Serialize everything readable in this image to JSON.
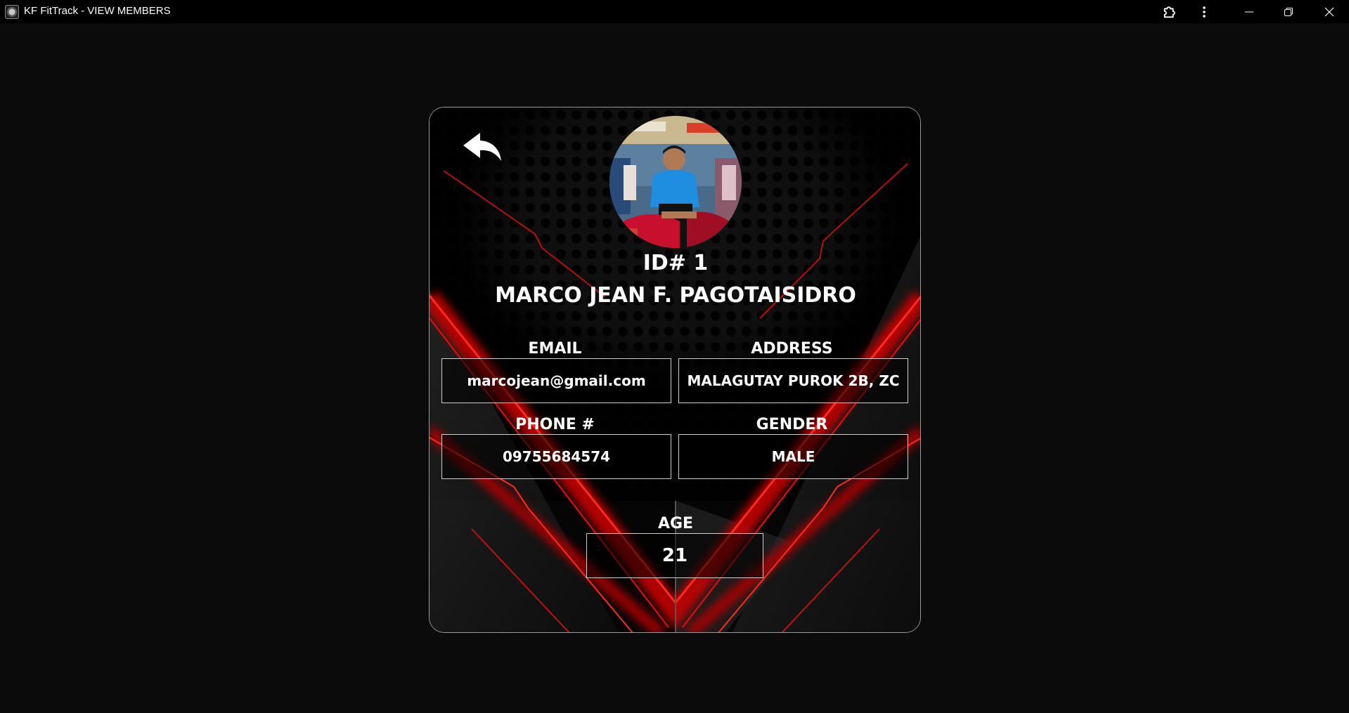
{
  "window": {
    "title": "KF FitTrack - VIEW MEMBERS"
  },
  "icons": {
    "app": "dumbbell-plate-icon",
    "extensions": "puzzle-icon",
    "more": "more-vertical-icon",
    "minimize": "minimize-icon",
    "restore": "restore-icon",
    "close": "close-icon",
    "back": "back-arrow-icon"
  },
  "member": {
    "id_text": "ID# 1",
    "name": "MARCO JEAN F. PAGOTAISIDRO"
  },
  "fields": {
    "email_label": "EMAIL",
    "email_value": "marcojean@gmail.com",
    "address_label": "ADDRESS",
    "address_value": "MALAGUTAY PUROK 2B, ZC",
    "phone_label": "PHONE #",
    "phone_value": "09755684574",
    "gender_label": "GENDER",
    "gender_value": "MALE",
    "age_label": "AGE",
    "age_value": "21"
  },
  "colors": {
    "accent_red": "#e01010",
    "background": "#0b0b0b",
    "text": "#ffffff"
  }
}
